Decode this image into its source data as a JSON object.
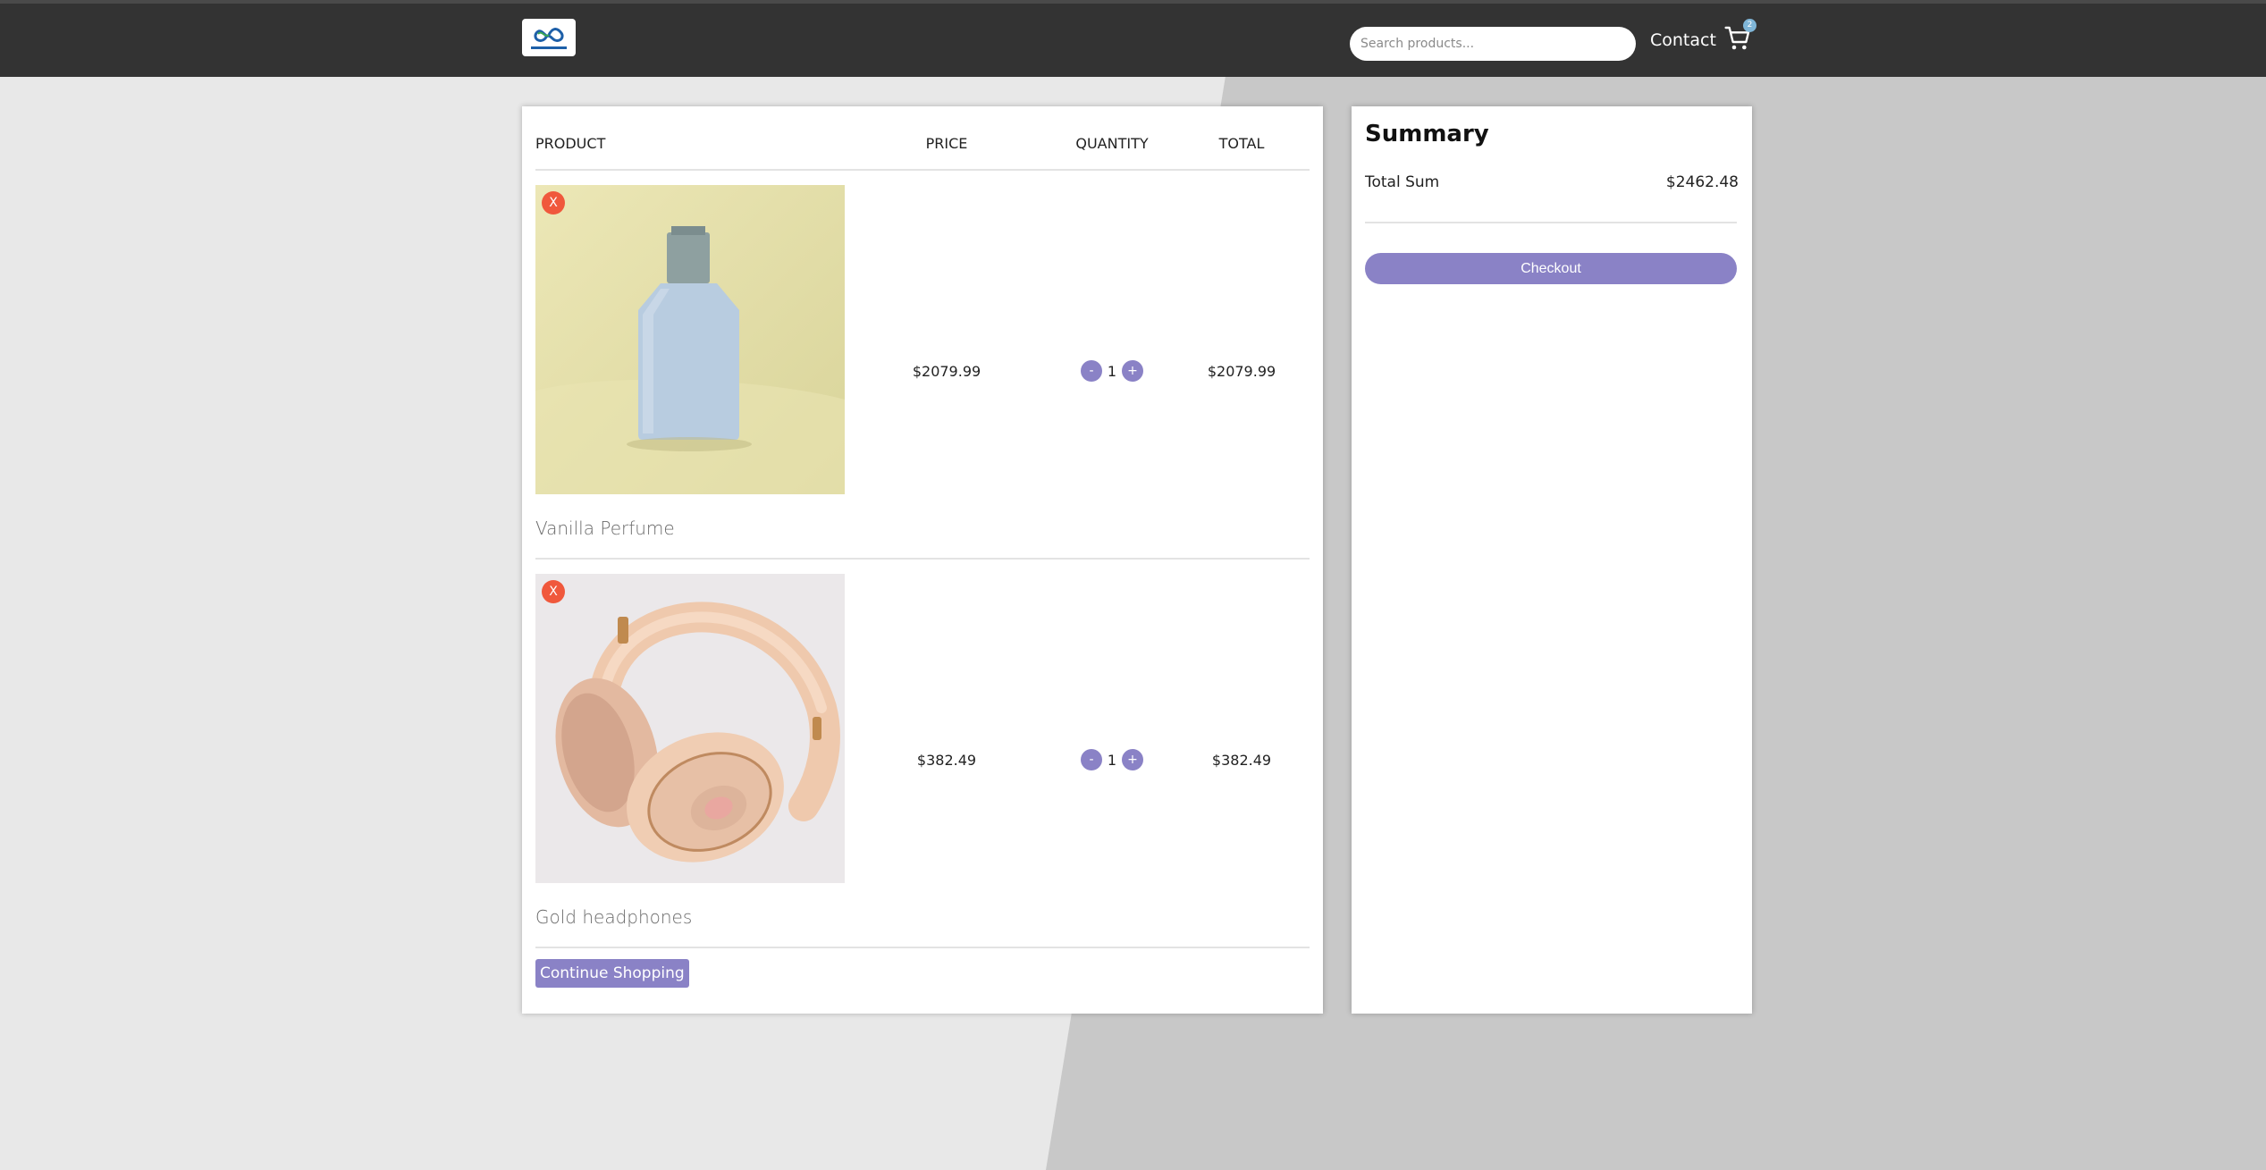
{
  "colors": {
    "nav_bg": "#333333",
    "accent": "#8a82c6",
    "remove": "#f0583c",
    "badge": "#7fb6d8"
  },
  "header": {
    "logo_alt": "Infinity Goods",
    "search_placeholder": "Search products...",
    "contact_label": "Contact",
    "cart_icon": "shopping-cart-icon",
    "cart_count": "2"
  },
  "cart": {
    "columns": {
      "product": "PRODUCT",
      "price": "PRICE",
      "quantity": "QUANTITY",
      "total": "TOTAL"
    },
    "items": [
      {
        "name": "Vanilla Perfume",
        "price": "$2079.99",
        "quantity": "1",
        "total": "$2079.99",
        "remove_label": "X",
        "decrement_label": "-",
        "increment_label": "+"
      },
      {
        "name": "Gold headphones",
        "price": "$382.49",
        "quantity": "1",
        "total": "$382.49",
        "remove_label": "X",
        "decrement_label": "-",
        "increment_label": "+"
      }
    ],
    "continue_label": "Continue Shopping"
  },
  "summary": {
    "title": "Summary",
    "total_label": "Total Sum",
    "total_value": "$2462.48",
    "checkout_label": "Checkout"
  }
}
